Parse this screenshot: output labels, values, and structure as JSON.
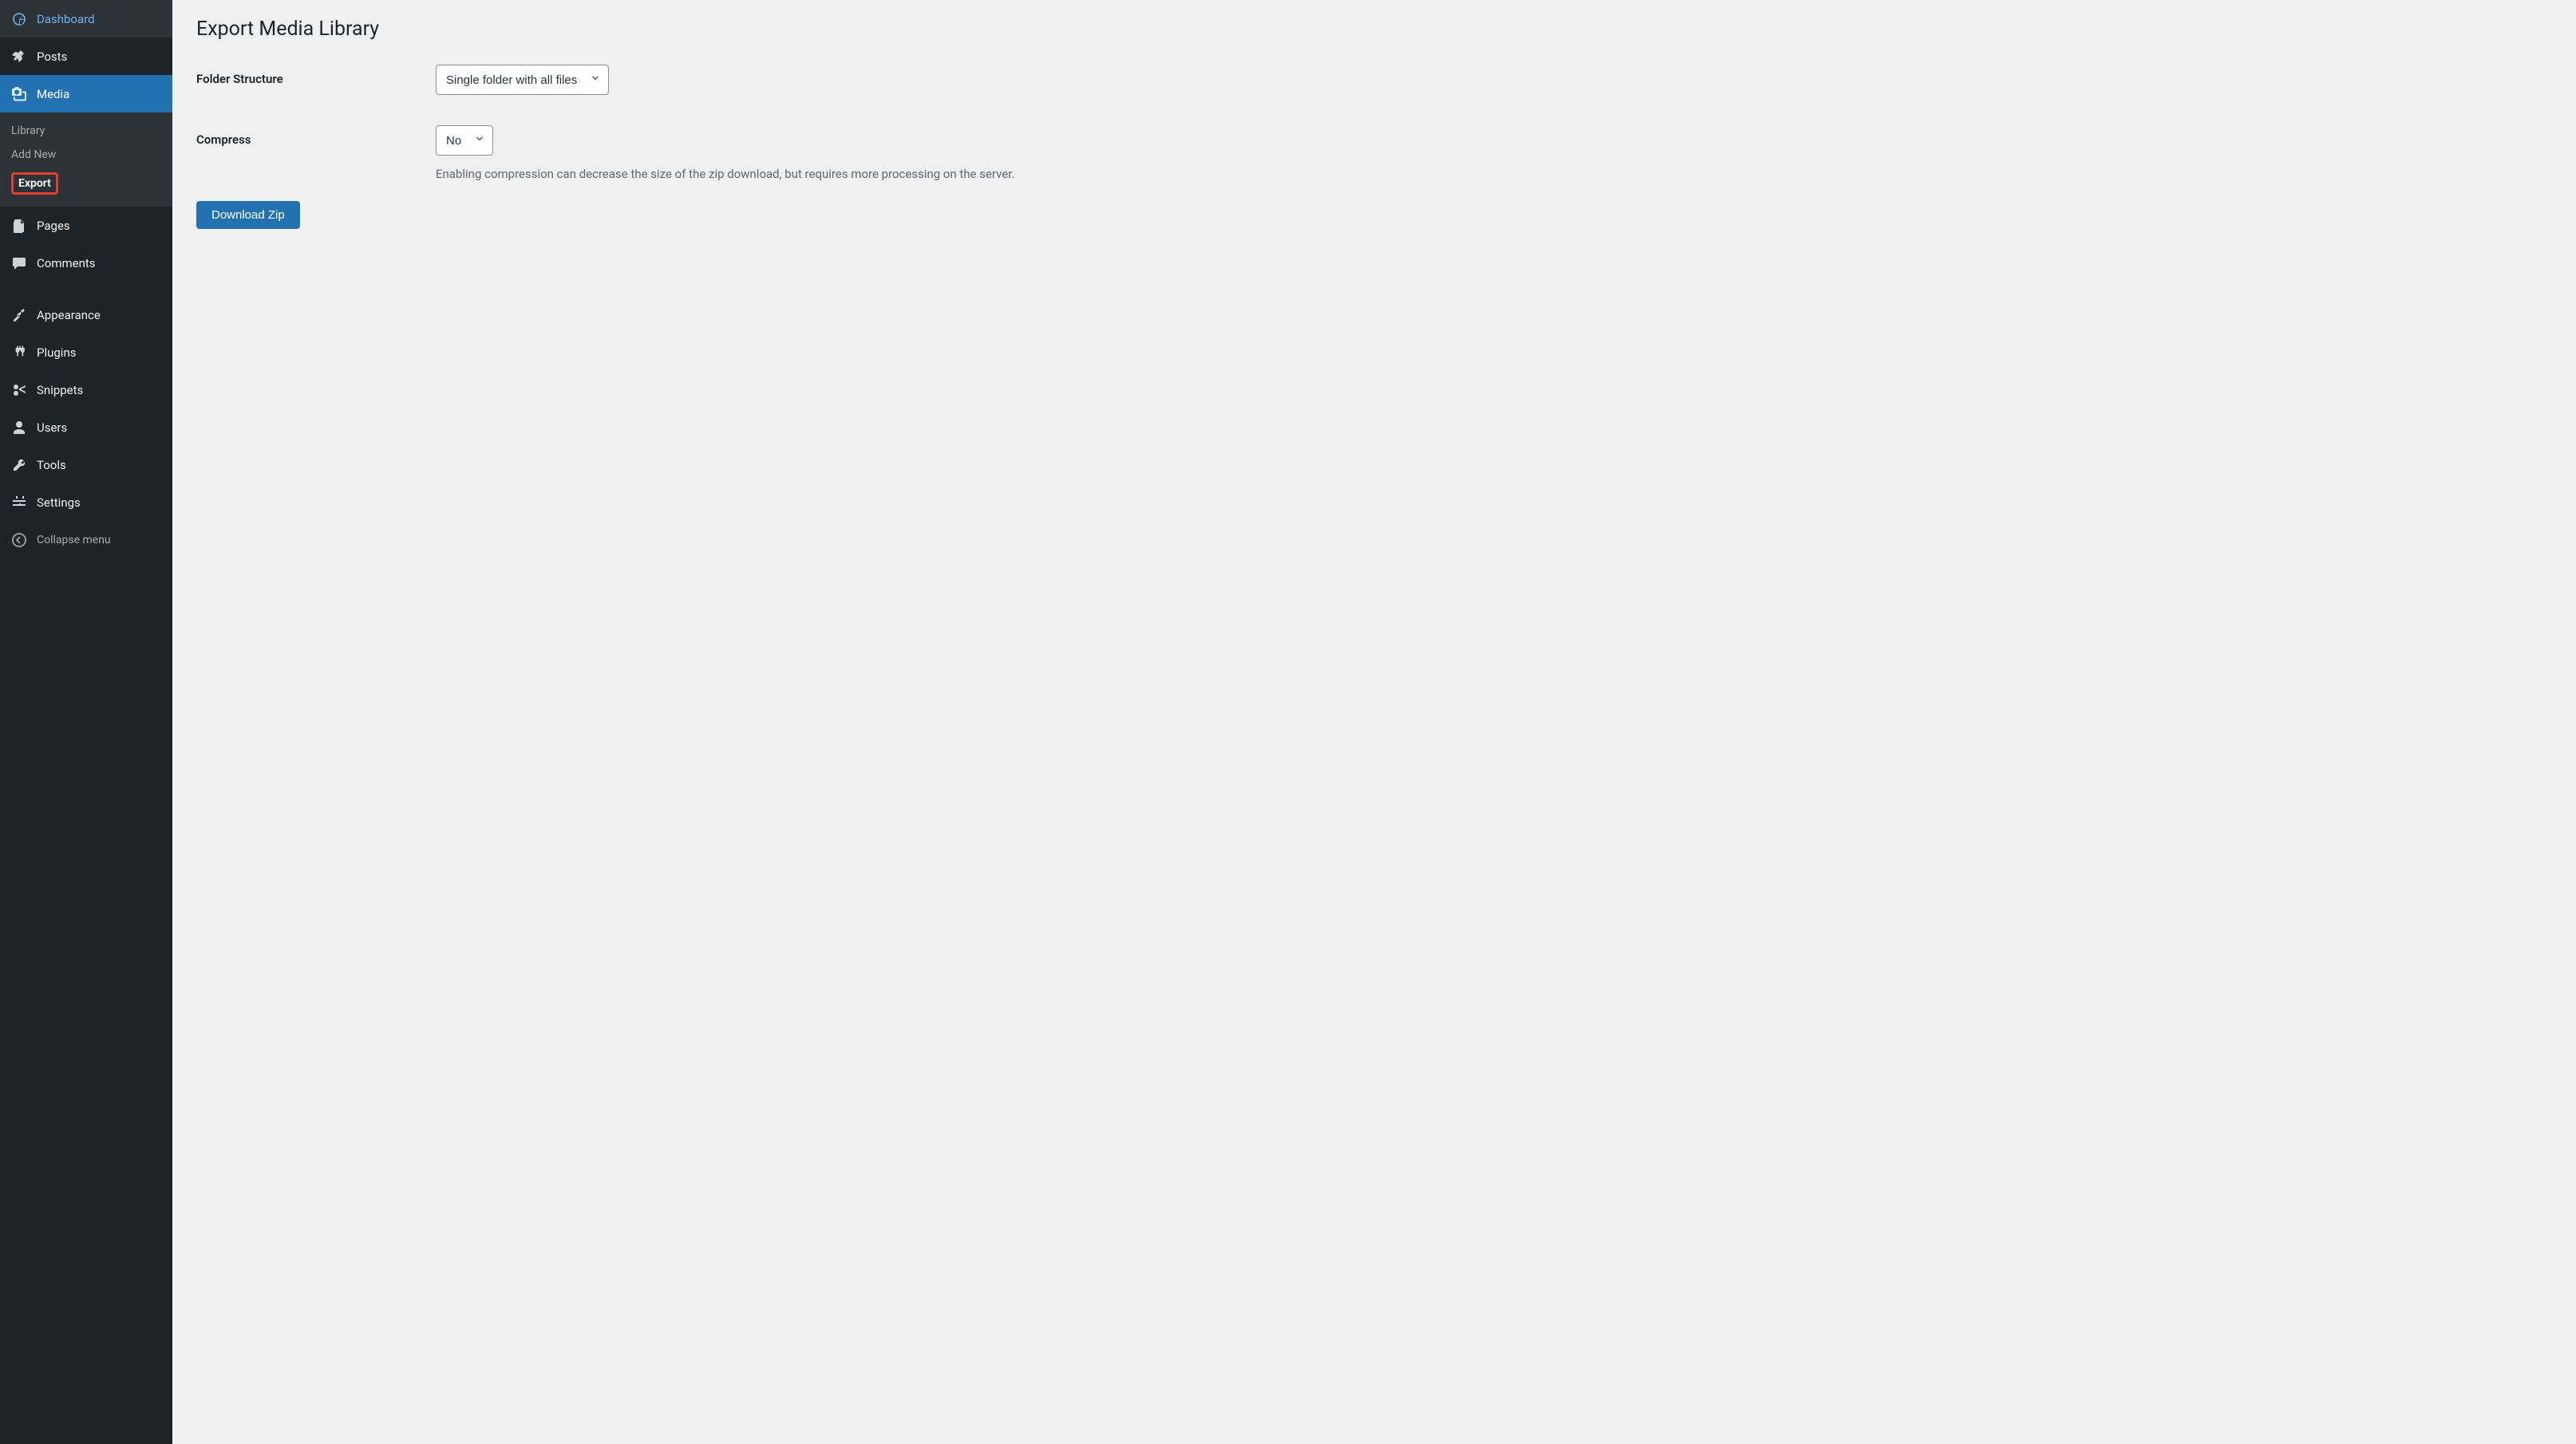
{
  "sidebar": {
    "dashboard": "Dashboard",
    "posts": "Posts",
    "media": "Media",
    "submenu": {
      "library": "Library",
      "add_new": "Add New",
      "export": "Export"
    },
    "pages": "Pages",
    "comments": "Comments",
    "appearance": "Appearance",
    "plugins": "Plugins",
    "snippets": "Snippets",
    "users": "Users",
    "tools": "Tools",
    "settings": "Settings",
    "collapse": "Collapse menu"
  },
  "page": {
    "title": "Export Media Library"
  },
  "form": {
    "folder_structure": {
      "label": "Folder Structure",
      "value": "Single folder with all files"
    },
    "compress": {
      "label": "Compress",
      "value": "No",
      "description": "Enabling compression can decrease the size of the zip download, but requires more processing on the server."
    },
    "submit": "Download Zip"
  }
}
